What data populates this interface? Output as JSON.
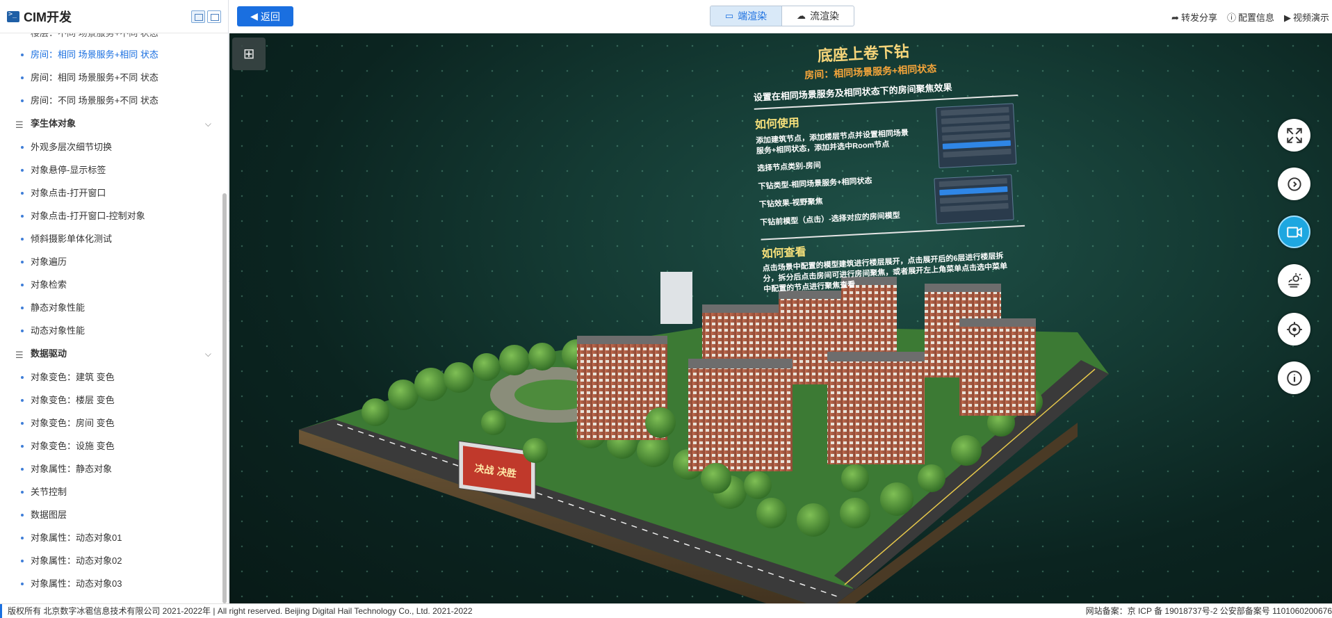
{
  "app": {
    "title": "CIM开发",
    "logo_icon": "terminal-icon"
  },
  "sidebar": {
    "cut_item": "楼层：不同 场景服务+不同 状态",
    "items_top": [
      {
        "label": "房间：相同 场景服务+相同 状态",
        "active": true
      },
      {
        "label": "房间：相同 场景服务+不同 状态"
      },
      {
        "label": "房间：不同 场景服务+不同 状态"
      }
    ],
    "groups": [
      {
        "label": "孪生体对象",
        "items": [
          "外观多层次细节切换",
          "对象悬停-显示标签",
          "对象点击-打开窗口",
          "对象点击-打开窗口-控制对象",
          "倾斜摄影单体化测试",
          "对象遍历",
          "对象检索",
          "静态对象性能",
          "动态对象性能"
        ]
      },
      {
        "label": "数据驱动",
        "items": [
          "对象变色：建筑 变色",
          "对象变色：楼层 变色",
          "对象变色：房间 变色",
          "对象变色：设施 变色",
          "对象属性：静态对象",
          "关节控制",
          "数据图层",
          "对象属性：动态对象01",
          "对象属性：动态对象02",
          "对象属性：动态对象03"
        ]
      }
    ]
  },
  "toolbar": {
    "back_label": "返回",
    "render_modes": [
      "端渲染",
      "流渲染"
    ],
    "active_mode": "端渲染",
    "right_links": [
      {
        "icon": "share-icon",
        "label": "转发分享"
      },
      {
        "icon": "info-icon",
        "label": "配置信息"
      },
      {
        "icon": "play-icon",
        "label": "视频演示"
      }
    ]
  },
  "panel": {
    "title": "底座上卷下钻",
    "subtitle": "房间：相同场景服务+相同状态",
    "desc": "设置在相同场景服务及相同状态下的房间聚焦效果",
    "howto_title": "如何使用",
    "howto_lines": [
      "添加建筑节点，添加楼层节点并设置相同场景服务+相同状态，添加并选中Room节点",
      "选择节点类别-房间",
      "下钻类型-相同场景服务+相同状态",
      "下钻效果-视野聚焦",
      "下钻前模型（点击）-选择对应的房间模型"
    ],
    "view_title": "如何查看",
    "view_text": "点击场景中配置的模型建筑进行楼层展开，点击展开后的6层进行楼层拆分，拆分后点击房间可进行房间聚焦，或者展开左上角菜单点击选中菜单中配置的节点进行聚焦查看",
    "billboard_text": "决战 决胜"
  },
  "right_controls": [
    {
      "icon": "fullscreen-icon"
    },
    {
      "icon": "rotate-icon"
    },
    {
      "icon": "video-camera-icon",
      "active": true
    },
    {
      "icon": "weather-icon"
    },
    {
      "icon": "locate-icon"
    },
    {
      "icon": "info-circle-icon"
    }
  ],
  "footer": {
    "copyright": "版权所有 北京数字冰雹信息技术有限公司 2021-2022年 | All right reserved. Beijing Digital Hail Technology Co., Ltd. 2021-2022",
    "icp": "网站备案：京 ICP 备 19018737号-2 公安部备案号 1101060200676"
  },
  "colors": {
    "accent": "#1a6fe0",
    "active_control": "#1ea7e0",
    "panel_title": "#f6d57a",
    "panel_subtitle": "#f5a53a"
  }
}
